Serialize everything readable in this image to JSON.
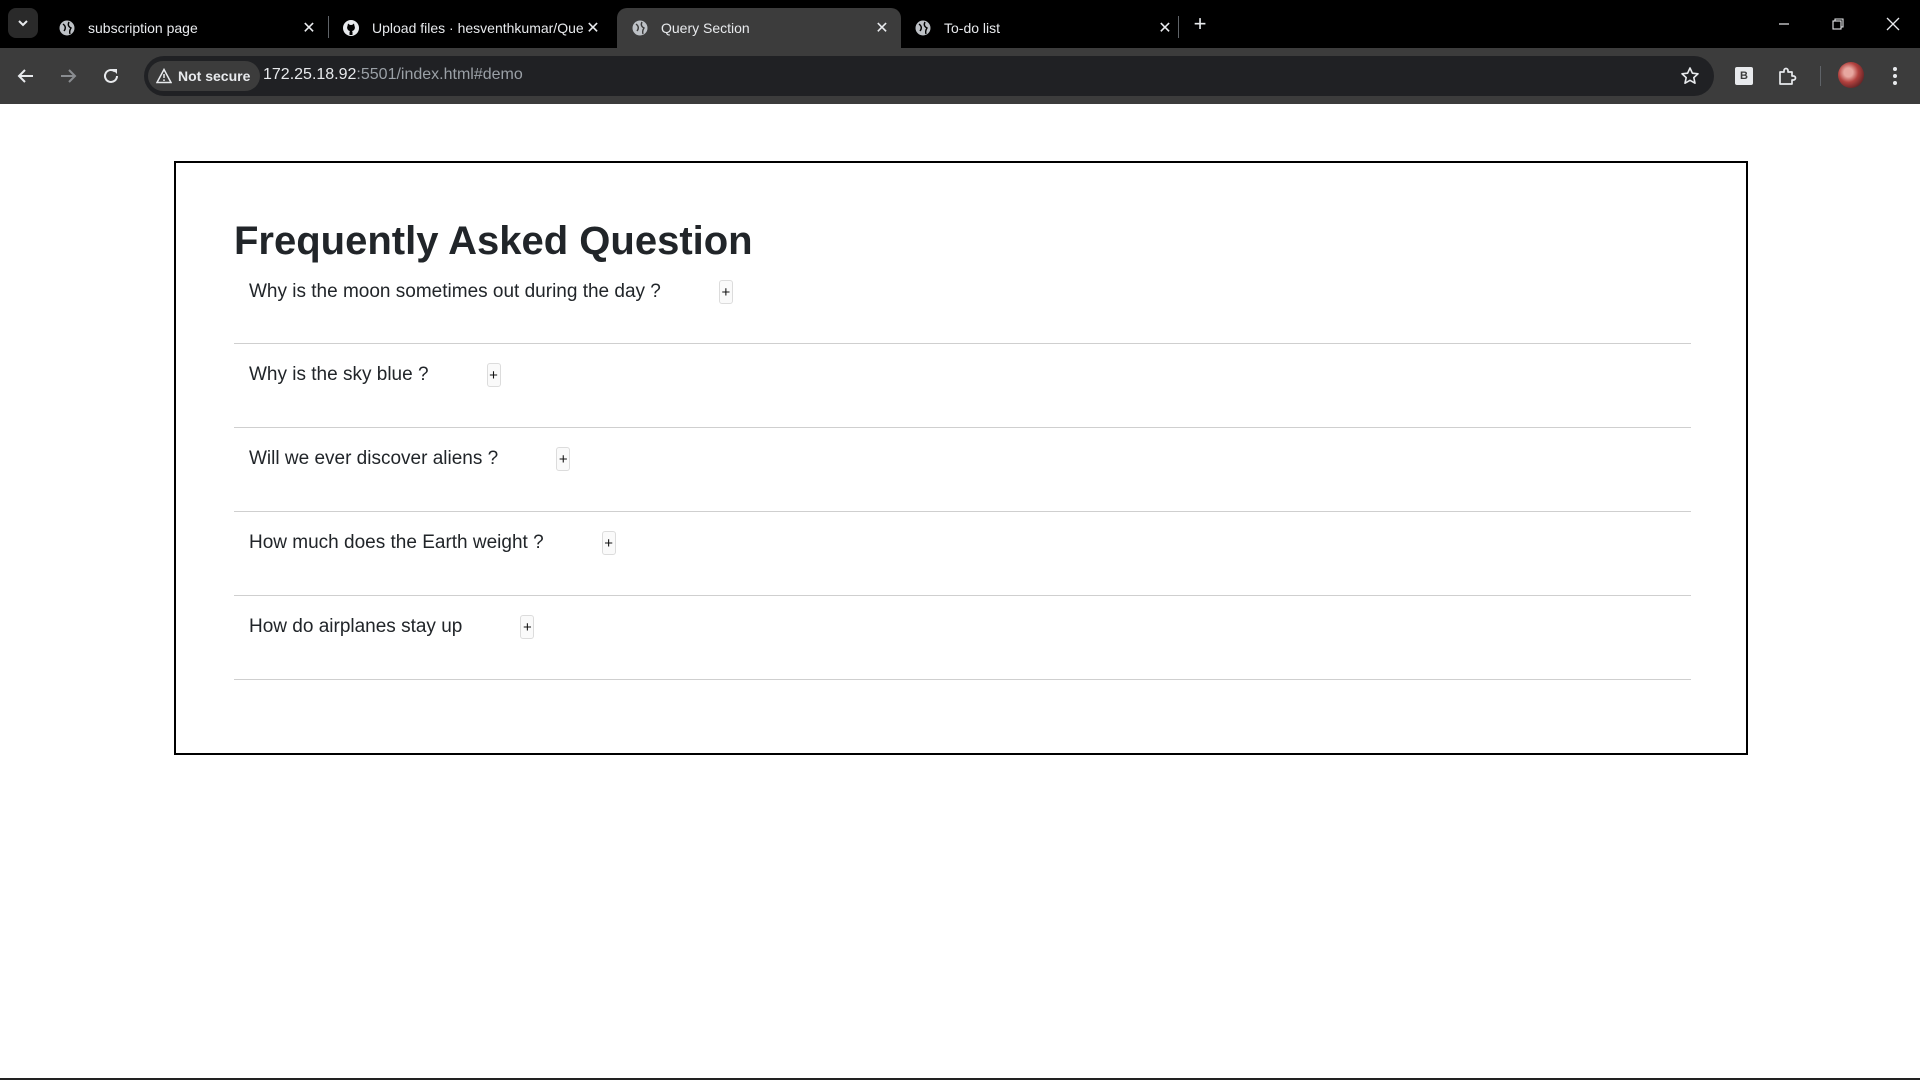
{
  "browser": {
    "tabs": [
      {
        "title": "subscription page",
        "icon": "globe-icon",
        "active": false
      },
      {
        "title": "Upload files · hesventhkumar/Query",
        "icon": "github-icon",
        "active": false
      },
      {
        "title": "Query Section",
        "icon": "globe-icon",
        "active": true
      },
      {
        "title": "To-do list",
        "icon": "globe-icon",
        "active": false
      }
    ],
    "security_label": "Not secure",
    "url_host": "172.25.18.92",
    "url_rest": ":5501/index.html#demo",
    "extension_badge": "B"
  },
  "faq": {
    "title": "Frequently Asked Question",
    "expand_symbol": "+",
    "items": [
      {
        "question": "Why is the moon sometimes out during the day ?"
      },
      {
        "question": "Why is the sky blue ?"
      },
      {
        "question": "Will we ever discover aliens ?"
      },
      {
        "question": "How much does the Earth weight ?"
      },
      {
        "question": "How do airplanes stay up"
      }
    ]
  }
}
